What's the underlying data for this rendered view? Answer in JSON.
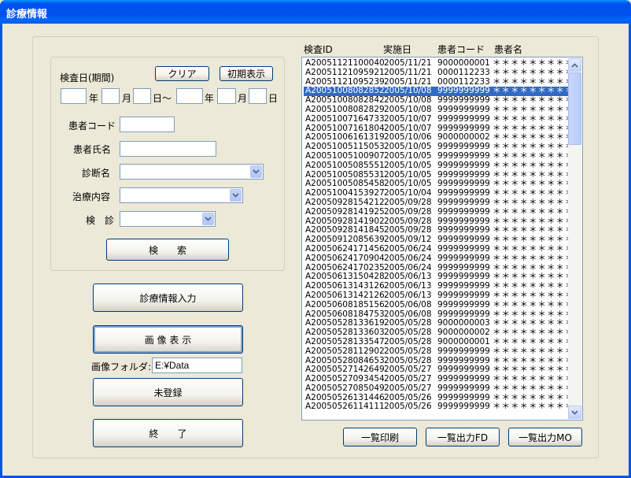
{
  "window": {
    "title": "診療情報"
  },
  "search": {
    "date_label": "検査日(期間)",
    "clear_label": "クリア",
    "reset_label": "初期表示",
    "year": "年",
    "month": "月",
    "day_tilde": "日〜",
    "day": "日",
    "patient_code_label": "患者コード",
    "patient_name_label": "患者氏名",
    "diagnosis_label": "診断名",
    "treatment_label": "治療内容",
    "exam_label": "検　診",
    "search_button": "検　　索"
  },
  "actions": {
    "medical_info_input": "診療情報入力",
    "image_display": "画 像 表 示",
    "image_folder_label": "画像フォルダ:",
    "image_folder_value": "E:¥Data",
    "unregistered": "未登録",
    "exit": "終　　了"
  },
  "list": {
    "headers": [
      "検査ID",
      "実施日",
      "患者コード",
      "患者名"
    ],
    "selected_index": 3,
    "rows": [
      [
        "A20051121100040",
        "2005/11/21",
        "9000000001",
        "＊＊＊＊＊＊＊＊＊"
      ],
      [
        "A20051121095921",
        "2005/11/21",
        "0000112233",
        "＊＊＊＊＊＊＊＊＊"
      ],
      [
        "A20051121095239",
        "2005/11/21",
        "0000112233",
        "＊＊＊＊＊＊＊＊＊"
      ],
      [
        "A20051008082852",
        "2005/10/08",
        "9999999999",
        "＊＊＊＊＊＊＊＊＊"
      ],
      [
        "A20051008082842",
        "2005/10/08",
        "9999999999",
        "＊＊＊＊＊＊＊＊＊"
      ],
      [
        "A20051008082829",
        "2005/10/08",
        "9999999999",
        "＊＊＊＊＊＊＊＊＊"
      ],
      [
        "A20051007164733",
        "2005/10/07",
        "9999999999",
        "＊＊＊＊＊＊＊＊＊"
      ],
      [
        "A20051007161804",
        "2005/10/07",
        "9999999999",
        "＊＊＊＊＊＊＊＊＊"
      ],
      [
        "A20051006161319",
        "2005/10/06",
        "9000000002",
        "＊＊＊＊＊＊＊＊＊"
      ],
      [
        "A20051005115053",
        "2005/10/05",
        "9999999999",
        "＊＊＊＊＊＊＊＊＊"
      ],
      [
        "A20051005100907",
        "2005/10/05",
        "9999999999",
        "＊＊＊＊＊＊＊＊＊"
      ],
      [
        "A20051005085551",
        "2005/10/05",
        "9999999999",
        "＊＊＊＊＊＊＊＊＊"
      ],
      [
        "A20051005085531",
        "2005/10/05",
        "9999999999",
        "＊＊＊＊＊＊＊＊＊"
      ],
      [
        "A20051005085458",
        "2005/10/05",
        "9999999999",
        "＊＊＊＊＊＊＊＊＊"
      ],
      [
        "A20051004153927",
        "2005/10/04",
        "9999999999",
        "＊＊＊＊＊＊＊＊＊"
      ],
      [
        "A20050928154212",
        "2005/09/28",
        "9999999999",
        "＊＊＊＊＊＊＊＊＊"
      ],
      [
        "A20050928141925",
        "2005/09/28",
        "9999999999",
        "＊＊＊＊＊＊＊＊＊"
      ],
      [
        "A20050928141902",
        "2005/09/28",
        "9999999999",
        "＊＊＊＊＊＊＊＊＊"
      ],
      [
        "A20050928141845",
        "2005/09/28",
        "9999999999",
        "＊＊＊＊＊＊＊＊＊"
      ],
      [
        "A20050912085639",
        "2005/09/12",
        "9999999999",
        "＊＊＊＊＊＊＊＊＊"
      ],
      [
        "A20050624171456",
        "2005/06/24",
        "9999999999",
        "＊＊＊＊＊＊＊＊＊"
      ],
      [
        "A20050624170904",
        "2005/06/24",
        "9999999999",
        "＊＊＊＊＊＊＊＊＊"
      ],
      [
        "A20050624170235",
        "2005/06/24",
        "9999999999",
        "＊＊＊＊＊＊＊＊＊"
      ],
      [
        "A20050613150428",
        "2005/06/13",
        "9999999999",
        "＊＊＊＊＊＊＊＊＊"
      ],
      [
        "A20050613143126",
        "2005/06/13",
        "9999999999",
        "＊＊＊＊＊＊＊＊＊"
      ],
      [
        "A20050613142126",
        "2005/06/13",
        "9999999999",
        "＊＊＊＊＊＊＊＊＊"
      ],
      [
        "A20050608185156",
        "2005/06/08",
        "9999999999",
        "＊＊＊＊＊＊＊＊＊"
      ],
      [
        "A20050608184753",
        "2005/06/08",
        "9999999999",
        "＊＊＊＊＊＊＊＊＊"
      ],
      [
        "A20050528133619",
        "2005/05/28",
        "9000000003",
        "＊＊＊＊＊＊＊＊＊"
      ],
      [
        "A20050528133603",
        "2005/05/28",
        "9000000002",
        "＊＊＊＊＊＊＊＊＊"
      ],
      [
        "A20050528133547",
        "2005/05/28",
        "9000000001",
        "＊＊＊＊＊＊＊＊＊"
      ],
      [
        "A20050528112902",
        "2005/05/28",
        "9999999999",
        "＊＊＊＊＊＊＊＊＊"
      ],
      [
        "A20050528084653",
        "2005/05/28",
        "9999999999",
        "＊＊＊＊＊＊＊＊＊"
      ],
      [
        "A20050527142649",
        "2005/05/27",
        "9999999999",
        "＊＊＊＊＊＊＊＊＊"
      ],
      [
        "A20050527093454",
        "2005/05/27",
        "9999999999",
        "＊＊＊＊＊＊＊＊＊"
      ],
      [
        "A20050527085049",
        "2005/05/27",
        "9999999999",
        "＊＊＊＊＊＊＊＊＊"
      ],
      [
        "A20050526131446",
        "2005/05/26",
        "9999999999",
        "＊＊＊＊＊＊＊＊＊"
      ],
      [
        "A20050526114111",
        "2005/05/26",
        "9999999999",
        "＊＊＊＊＊＊＊＊＊"
      ]
    ]
  },
  "bottom_buttons": {
    "print_list": "一覧印刷",
    "output_fd": "一覧出力FD",
    "output_mo": "一覧出力MO"
  },
  "icons": {
    "combo_arrow": "chevron-down-icon",
    "scroll_up": "arrow-up-icon",
    "scroll_down": "arrow-down-icon"
  }
}
